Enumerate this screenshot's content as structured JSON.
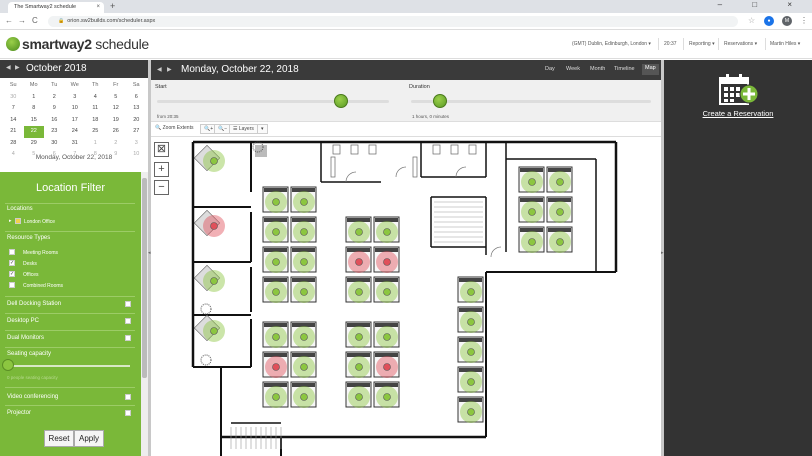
{
  "browser": {
    "tab_title": "The Smartway2 schedule",
    "tab_close": "×",
    "new_tab": "+",
    "window_controls": "–  □  ×",
    "url": "orion.sw2builds.com/scheduler.aspx",
    "url_lock": "🔒",
    "nav": {
      "back": "←",
      "forward": "→",
      "reload": "C"
    },
    "avatar_initial": "M"
  },
  "app": {
    "logo_bold": "smartway2",
    "logo_rest": " schedule",
    "timezone": "(GMT) Dublin, Edinburgh, London ▾",
    "time": "20:37",
    "menu": [
      "Reporting ▾",
      "Reservations ▾",
      "Martin Hiles ▾"
    ]
  },
  "calendar": {
    "month_title": "October 2018",
    "prev": "◀",
    "next": "▶",
    "dow": [
      "Su",
      "Mo",
      "Tu",
      "We",
      "Th",
      "Fr",
      "Sa"
    ],
    "weeks": [
      [
        "30",
        "1",
        "2",
        "3",
        "4",
        "5",
        "6"
      ],
      [
        "7",
        "8",
        "9",
        "10",
        "11",
        "12",
        "13"
      ],
      [
        "14",
        "15",
        "16",
        "17",
        "18",
        "19",
        "20"
      ],
      [
        "21",
        "22",
        "23",
        "24",
        "25",
        "26",
        "27"
      ],
      [
        "28",
        "29",
        "30",
        "31",
        "1",
        "2",
        "3"
      ],
      [
        "4",
        "5",
        "6",
        "7",
        "8",
        "9",
        "10"
      ]
    ],
    "selected": "22",
    "caption": "Monday, October 22, 2018"
  },
  "filter": {
    "title": "Location Filter",
    "locations_label": "Locations",
    "location_item": "London Office",
    "resource_types_label": "Resource Types",
    "resource_types": [
      {
        "label": "Meeting Rooms",
        "checked": false
      },
      {
        "label": "Desks",
        "checked": true
      },
      {
        "label": "Offices",
        "checked": true
      },
      {
        "label": "Combined Rooms",
        "checked": false
      }
    ],
    "features": [
      "Dell Docking Station",
      "Desktop PC",
      "Dual Monitors"
    ],
    "seating_label": "Seating capacity",
    "seating_hint": "0 people seating capacity",
    "features2": [
      "Video conferencing",
      "Projector"
    ],
    "reset_label": "Reset",
    "apply_label": "Apply",
    "check_mark": "✓"
  },
  "center": {
    "date_title": "Monday, October 22, 2018",
    "prev": "◀",
    "next": "▶",
    "views": [
      "Day",
      "Week",
      "Month",
      "Timeline",
      "Map"
    ],
    "active_view": "Map",
    "start_label": "Start",
    "start_sub": "from 20:35",
    "duration_label": "Duration",
    "duration_sub": "1 hours, 0 minutes",
    "zoom_extents": "Zoom Extents",
    "zoom_in": "🔍+",
    "zoom_out": "🔍−",
    "layers": "Layers",
    "layers_menu": "▾",
    "map_ctrl_box": "⊠",
    "map_ctrl_plus": "+",
    "map_ctrl_minus": "−"
  },
  "right": {
    "create_label": "Create a Reservation"
  },
  "colors": {
    "accent_green": "#7ab839",
    "dark": "#333333",
    "available": "#8cc640",
    "booked": "#e0505a"
  }
}
